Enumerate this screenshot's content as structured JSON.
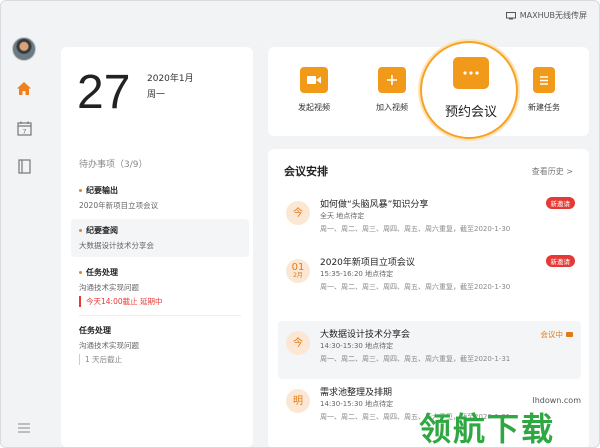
{
  "titlebar": {
    "cast_label": "MAXHUB无线传屏"
  },
  "sidebar": {
    "items": [
      "avatar",
      "home-icon",
      "calendar-icon",
      "notebook-icon",
      "menu-icon"
    ],
    "calendar_day": "7"
  },
  "date": {
    "day": "27",
    "year_month": "2020年1月",
    "weekday": "周一"
  },
  "todos": {
    "title": "待办事项（3/9）",
    "items": [
      {
        "title": "纪要输出",
        "sub": "2020年新项目立项会议"
      },
      {
        "title": "纪要查阅",
        "sub": "大数据设计技术分享会"
      },
      {
        "title": "任务处理",
        "sub": "沟通技术实现问题",
        "note": "今天14:00截止 延期中"
      },
      {
        "title": "任务处理",
        "sub": "沟通技术实现问题",
        "note": "1 天后截止"
      }
    ]
  },
  "actions": {
    "start_video": "发起视频",
    "join_video": "加入视频",
    "book_meeting": "预约会议",
    "new_task": "新建任务"
  },
  "meetings": {
    "title": "会议安排",
    "history": "查看历史 >",
    "items": [
      {
        "day": "今",
        "month": "",
        "name": "如何做“头脑风暴”知识分享",
        "time": "全天     地点待定",
        "repeat": "周一、周二、周三、周四、周五、周六重复，截至2020-1-30",
        "badge": "新邀请"
      },
      {
        "day": "01",
        "month": "2月",
        "name": "2020年新项目立项会议",
        "time": "15:35-16:20     地点待定",
        "repeat": "周一、周二、周三、周四、周五、周六重复，截至2020-1-30",
        "badge": "新邀请"
      },
      {
        "day": "今",
        "month": "",
        "name": "大数据设计技术分享会",
        "time": "14:30-15:30     地点待定",
        "repeat": "周一、周二、周三、周四、周五、周六重复，截至2020-1-31",
        "status": "会议中"
      },
      {
        "day": "明",
        "month": "",
        "name": "需求池整理及排期",
        "time": "14:30-15:30     地点待定",
        "repeat": "周一、周二、周三、周四、周五、周六重复，截至2020-1-31"
      }
    ]
  },
  "watermark": {
    "text": "领航下载",
    "url": "lhdown.com"
  },
  "colors": {
    "accent": "#f19a1a",
    "alert": "#e53935",
    "watermark": "#2fa843"
  }
}
